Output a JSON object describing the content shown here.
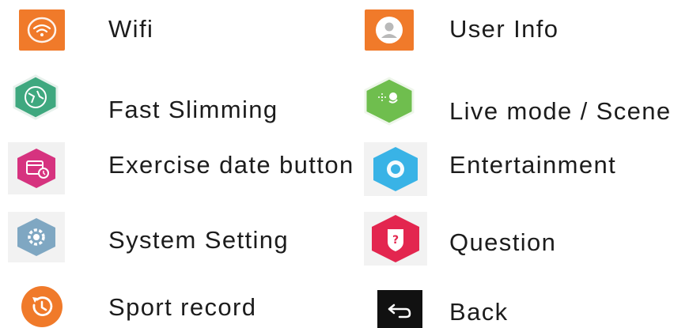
{
  "legend": {
    "items": [
      {
        "label": "Wifi",
        "icon": "wifi-icon",
        "color": "#f07a2a"
      },
      {
        "label": "User Info",
        "icon": "user-info-icon",
        "color": "#f07a2a"
      },
      {
        "label": "Fast Slimming",
        "icon": "fast-slimming-icon",
        "color": "#3fa87f"
      },
      {
        "label": "Live mode / Scene",
        "icon": "live-mode-scene-icon",
        "color": "#6fbe4e"
      },
      {
        "label": "Exercise date button",
        "icon": "exercise-date-icon",
        "color": "#d6337f"
      },
      {
        "label": "Entertainment",
        "icon": "entertainment-icon",
        "color": "#39b3e6"
      },
      {
        "label": "System Setting",
        "icon": "system-setting-icon",
        "color": "#7fa7c2"
      },
      {
        "label": "Question",
        "icon": "question-icon",
        "color": "#e3264f"
      },
      {
        "label": "Sport record",
        "icon": "sport-record-icon",
        "color": "#f07a2a"
      },
      {
        "label": "Back",
        "icon": "back-icon",
        "color": "#111111"
      }
    ]
  }
}
